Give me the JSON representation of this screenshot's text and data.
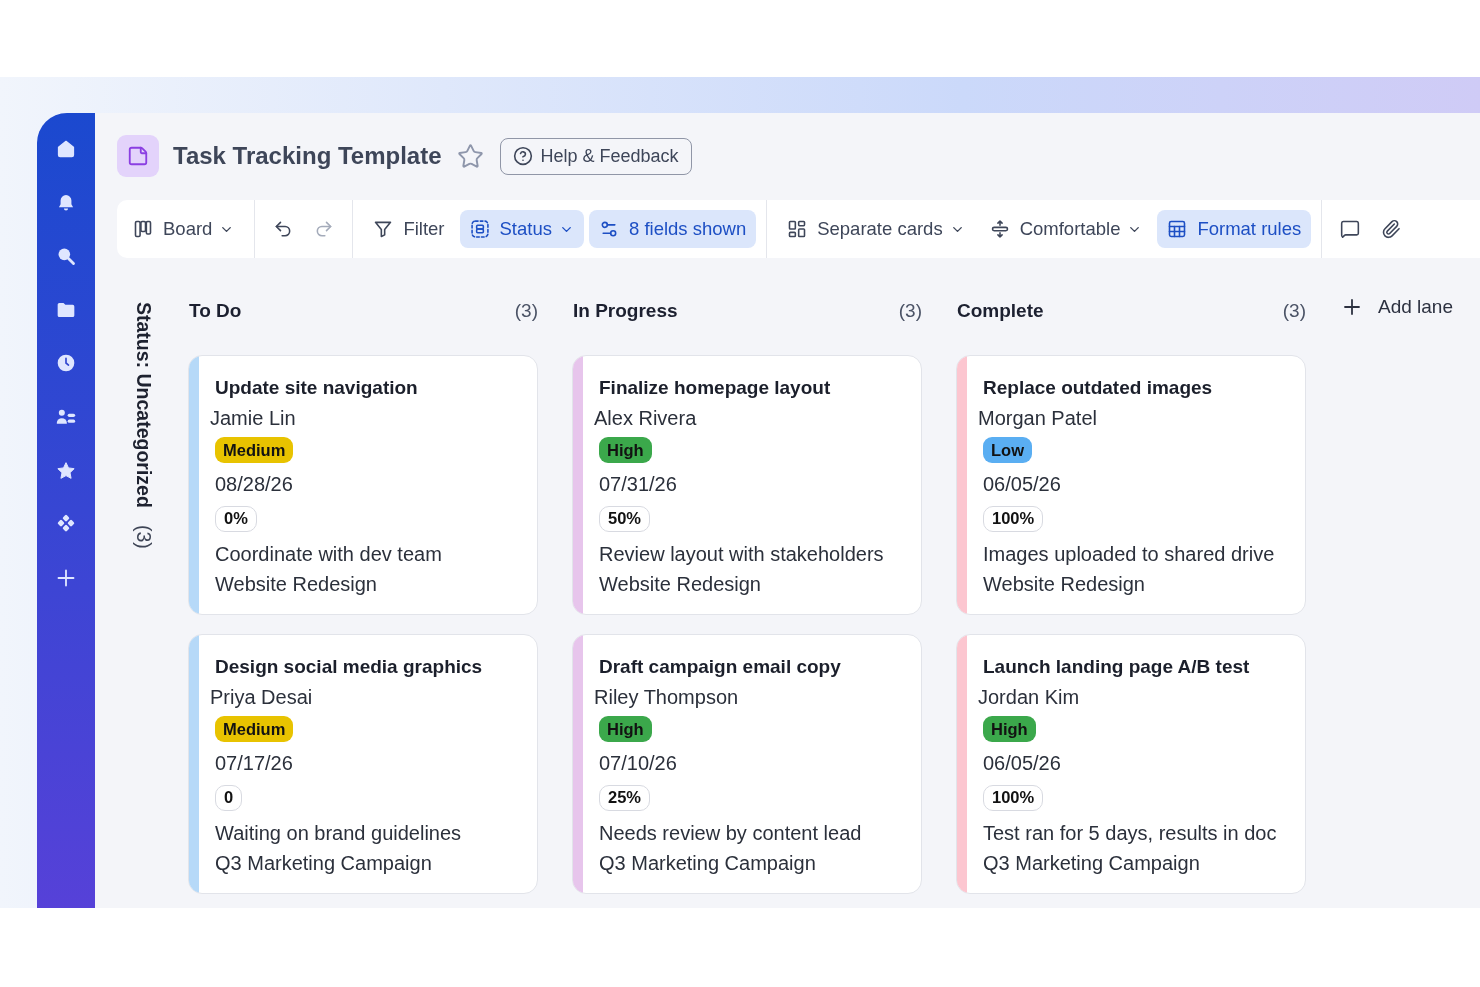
{
  "header": {
    "title": "Task Tracking Template",
    "starred": false,
    "help_button": "Help & Feedback"
  },
  "toolbar": {
    "groups": [
      {
        "items": [
          {
            "kind": "view",
            "label": "Board",
            "active": false,
            "dropdown": true,
            "disabled": false
          }
        ]
      },
      {
        "items": [
          {
            "kind": "undo",
            "active": false,
            "dropdown": false,
            "disabled": false
          },
          {
            "kind": "redo",
            "active": false,
            "dropdown": false,
            "disabled": true
          }
        ]
      },
      {
        "items": [
          {
            "kind": "filter",
            "label": "Filter",
            "active": false,
            "dropdown": false,
            "disabled": false
          },
          {
            "kind": "group",
            "label": "Status",
            "active": true,
            "dropdown": true,
            "disabled": false
          },
          {
            "kind": "fields",
            "label": "8 fields shown",
            "active": true,
            "dropdown": false,
            "disabled": false
          }
        ]
      },
      {
        "items": [
          {
            "kind": "cards",
            "label": "Separate cards",
            "active": false,
            "dropdown": true,
            "disabled": false
          },
          {
            "kind": "density",
            "label": "Comfortable",
            "active": false,
            "dropdown": true,
            "disabled": false
          },
          {
            "kind": "format",
            "label": "Format rules",
            "active": true,
            "dropdown": false,
            "disabled": false
          }
        ]
      },
      {
        "items": [
          {
            "kind": "comments",
            "active": false,
            "dropdown": false,
            "disabled": false
          },
          {
            "kind": "attachments",
            "active": false,
            "dropdown": false,
            "disabled": false
          }
        ]
      }
    ]
  },
  "board": {
    "group": {
      "label": "Status: Uncategorized",
      "count": "(3)"
    },
    "lanes": [
      {
        "title": "To Do",
        "count": "(3)",
        "color": "#b6d9f8",
        "cards": [
          {
            "title": "Update site navigation",
            "assignee": "Jamie Lin",
            "priority": {
              "label": "Medium",
              "color": "#e8c300"
            },
            "due_date": "08/28/26",
            "progress": "0%",
            "note": "Coordinate with dev team",
            "project": "Website Redesign"
          },
          {
            "title": "Design social media graphics",
            "assignee": "Priya Desai",
            "priority": {
              "label": "Medium",
              "color": "#e8c300"
            },
            "due_date": "07/17/26",
            "progress": "0",
            "note": "Waiting on brand guidelines",
            "project": "Q3 Marketing Campaign"
          }
        ]
      },
      {
        "title": "In Progress",
        "count": "(3)",
        "color": "#e7c5ec",
        "cards": [
          {
            "title": "Finalize homepage layout",
            "assignee": "Alex Rivera",
            "priority": {
              "label": "High",
              "color": "#3ba84b"
            },
            "due_date": "07/31/26",
            "progress": "50%",
            "note": "Review layout with stakeholders",
            "project": "Website Redesign"
          },
          {
            "title": "Draft campaign email copy",
            "assignee": "Riley Thompson",
            "priority": {
              "label": "High",
              "color": "#3ba84b"
            },
            "due_date": "07/10/26",
            "progress": "25%",
            "note": "Needs review by content lead",
            "project": "Q3 Marketing Campaign"
          }
        ]
      },
      {
        "title": "Complete",
        "count": "(3)",
        "color": "#fcc6d0",
        "cards": [
          {
            "title": "Replace outdated images",
            "assignee": "Morgan Patel",
            "priority": {
              "label": "Low",
              "color": "#5aaef2"
            },
            "due_date": "06/05/26",
            "progress": "100%",
            "note": "Images uploaded to shared drive",
            "project": "Website Redesign"
          },
          {
            "title": "Launch landing page A/B test",
            "assignee": "Jordan Kim",
            "priority": {
              "label": "High",
              "color": "#3ba84b"
            },
            "due_date": "06/05/26",
            "progress": "100%",
            "note": "Test ran for 5 days, results in doc",
            "project": "Q3 Marketing Campaign"
          }
        ]
      }
    ],
    "add_lane": "Add lane"
  }
}
